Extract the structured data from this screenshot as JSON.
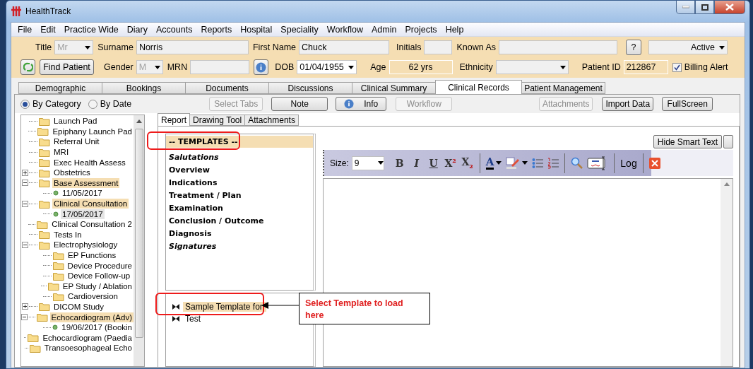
{
  "window": {
    "title": "HealthTrack"
  },
  "menu": [
    "File",
    "Edit",
    "Practice Wide",
    "Diary",
    "Accounts",
    "Reports",
    "Hospital",
    "Speciality",
    "Workflow",
    "Admin",
    "Projects",
    "Help"
  ],
  "patient": {
    "title": {
      "label": "Title",
      "value": "Mr",
      "disabled": true
    },
    "surname": {
      "label": "Surname",
      "value": "Norris"
    },
    "first_name": {
      "label": "First Name",
      "value": "Chuck"
    },
    "initials": {
      "label": "Initials"
    },
    "known_as": {
      "label": "Known As"
    },
    "help_button": "?",
    "status": {
      "value": "Active"
    },
    "find_button": "Find Patient",
    "gender": {
      "label": "Gender",
      "value": "M",
      "disabled": true
    },
    "mrn": {
      "label": "MRN"
    },
    "dob": {
      "label": "DOB",
      "value": "01/04/1955"
    },
    "age": {
      "label": "Age",
      "value": "62 yrs"
    },
    "ethnicity": {
      "label": "Ethnicity"
    },
    "patient_id": {
      "label": "Patient ID",
      "value": "212867"
    },
    "billing_alert": {
      "label": "Billing Alert",
      "checked": true
    }
  },
  "tabs": [
    {
      "label": "Demographic",
      "selected": false
    },
    {
      "label": "Bookings",
      "selected": false
    },
    {
      "label": "Documents",
      "selected": false
    },
    {
      "label": "Discussions",
      "selected": false
    },
    {
      "label": "Clinical Summary",
      "selected": false
    },
    {
      "label": "Clinical Records",
      "selected": true
    },
    {
      "label": "Patient Management",
      "selected": false
    }
  ],
  "view_options": [
    {
      "label": "By Category",
      "selected": true
    },
    {
      "label": "By Date",
      "selected": false
    }
  ],
  "toolbar": [
    {
      "label": "Select Tabs",
      "disabled": true
    },
    {
      "label": "Note",
      "disabled": false
    },
    {
      "label": "Info",
      "disabled": false,
      "kind": "info"
    },
    {
      "label": "Workflow",
      "disabled": true
    },
    {
      "label": "Attachments",
      "disabled": true
    },
    {
      "label": "Import Data",
      "disabled": false
    },
    {
      "label": "FullScreen",
      "disabled": false
    }
  ],
  "tree": [
    {
      "label": "Launch Pad",
      "kind": "folder",
      "highlighted": false,
      "selected": false
    },
    {
      "label": "Epiphany Launch Pad",
      "kind": "folder",
      "highlighted": false,
      "selected": false
    },
    {
      "label": "Referral Unit",
      "kind": "folder",
      "highlighted": false,
      "selected": false
    },
    {
      "label": "MRI",
      "kind": "folder",
      "highlighted": false,
      "selected": false
    },
    {
      "label": "Exec Health Assess",
      "kind": "folder",
      "highlighted": false,
      "selected": false
    },
    {
      "label": "Obstetrics",
      "kind": "folder",
      "highlighted": false,
      "selected": false,
      "expanded": false
    },
    {
      "label": "Base Assessment",
      "kind": "folder",
      "highlighted": true,
      "selected": false,
      "expanded": true,
      "children": [
        {
          "label": "11/05/2017",
          "kind": "entry",
          "highlighted": false,
          "selected": false
        }
      ]
    },
    {
      "label": "Clinical Consultation",
      "kind": "folder",
      "highlighted": true,
      "selected": false,
      "expanded": true,
      "children": [
        {
          "label": "17/05/2017",
          "kind": "entry",
          "highlighted": false,
          "selected": true
        }
      ]
    },
    {
      "label": "Clinical Consultation 2",
      "kind": "folder",
      "highlighted": false,
      "selected": false
    },
    {
      "label": "Tests In",
      "kind": "folder",
      "highlighted": false,
      "selected": false
    },
    {
      "label": "Electrophysiology",
      "kind": "folder",
      "highlighted": false,
      "selected": false,
      "expanded": true,
      "children": [
        {
          "label": "EP Functions",
          "kind": "folder",
          "highlighted": false,
          "selected": false
        },
        {
          "label": "Device Procedure",
          "kind": "folder",
          "highlighted": false,
          "selected": false
        },
        {
          "label": "Device Follow-up",
          "kind": "folder",
          "highlighted": false,
          "selected": false
        },
        {
          "label": "EP Study / Ablation",
          "kind": "folder",
          "highlighted": false,
          "selected": false
        },
        {
          "label": "Cardioversion",
          "kind": "folder",
          "highlighted": false,
          "selected": false
        }
      ]
    },
    {
      "label": "DICOM Study",
      "kind": "folder",
      "highlighted": false,
      "selected": false,
      "expanded": false
    },
    {
      "label": "Echocardiogram (Adv)",
      "kind": "folder",
      "highlighted": true,
      "selected": false,
      "expanded": true,
      "children": [
        {
          "label": "19/06/2017 (Bookin",
          "kind": "entry",
          "highlighted": false,
          "selected": false
        }
      ]
    },
    {
      "label": "Echocardiogram (Paedia",
      "kind": "folder",
      "highlighted": false,
      "selected": false
    },
    {
      "label": "Transoesophageal Echo",
      "kind": "folder",
      "highlighted": false,
      "selected": false
    }
  ],
  "report_tabs": [
    {
      "label": "Report",
      "selected": true
    },
    {
      "label": "Drawing Tool",
      "selected": false
    },
    {
      "label": "Attachments",
      "selected": false
    }
  ],
  "templates": {
    "header": "-- TEMPLATES --",
    "items": [
      {
        "label": "Salutations",
        "italic": true
      },
      {
        "label": "Overview",
        "italic": false
      },
      {
        "label": "Indications",
        "italic": false
      },
      {
        "label": "Treatment / Plan",
        "italic": false
      },
      {
        "label": "Examination",
        "italic": false
      },
      {
        "label": "Conclusion / Outcome",
        "italic": false
      },
      {
        "label": "Diagnosis",
        "italic": false
      },
      {
        "label": "Signatures",
        "italic": true
      }
    ]
  },
  "template_tree": [
    {
      "label": "Sample Template for",
      "selected": true
    },
    {
      "label": "Test",
      "selected": false
    }
  ],
  "editor": {
    "hide_smart_text": "Hide Smart Text",
    "size_label": "Size:",
    "size_value": "9",
    "format_buttons": [
      {
        "label": "B",
        "kind": "bold"
      },
      {
        "label": "I",
        "kind": "italic"
      },
      {
        "label": "U",
        "kind": "underline"
      },
      {
        "label": "X$^{2}$",
        "kind": "superscript"
      },
      {
        "label": "X$_{2}$",
        "kind": "subscript"
      }
    ],
    "font_color": "A",
    "log_button": "Log"
  },
  "callout": "Select Template to load here"
}
